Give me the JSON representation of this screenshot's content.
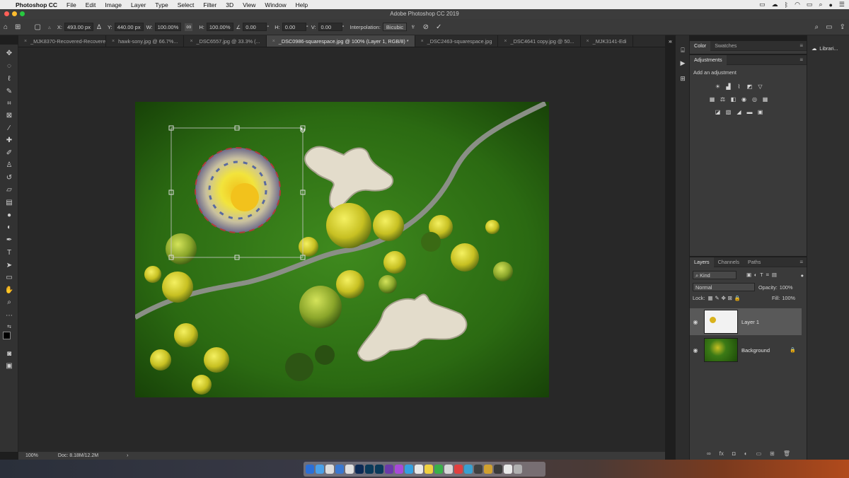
{
  "menubar": {
    "app": "Photoshop CC",
    "items": [
      "File",
      "Edit",
      "Image",
      "Layer",
      "Type",
      "Select",
      "Filter",
      "3D",
      "View",
      "Window",
      "Help"
    ]
  },
  "window_title": "Adobe Photoshop CC 2019",
  "options": {
    "x_label": "X:",
    "x_value": "493.00 px",
    "y_label": "Y:",
    "y_value": "440.00 px",
    "w_label": "W:",
    "w_value": "100.00%",
    "h_label": "H:",
    "h_value": "100.00%",
    "angle_value": "0.00",
    "angle_unit": "°",
    "hskew_label": "H:",
    "hskew_value": "0.00",
    "vskew_label": "V:",
    "vskew_value": "0.00",
    "skew_unit": "°",
    "interp_label": "Interpolation:",
    "interp_value": "Bicubic"
  },
  "tabs": [
    {
      "label": "_MJK8370-Recovered-Recovered.JPG",
      "active": false
    },
    {
      "label": "hawk-sony.jpg @ 66.7%...",
      "active": false
    },
    {
      "label": "_DSC6557.jpg @ 33.3% (...",
      "active": false
    },
    {
      "label": "_DSC0986-squarespace.jpg @ 100% (Layer 1, RGB/8) *",
      "active": true
    },
    {
      "label": "_DSC2463-squarespace.jpg",
      "active": false
    },
    {
      "label": "_DSC4641 copy.jpg @ 50...",
      "active": false
    },
    {
      "label": "_MJK3141-Edi",
      "active": false
    }
  ],
  "status": {
    "zoom": "100%",
    "doc": "Doc: 8.18M/12.2M"
  },
  "color_panel": {
    "tabs": [
      "Color",
      "Swatches"
    ]
  },
  "adjustments_panel": {
    "title": "Adjustments",
    "subtitle": "Add an adjustment"
  },
  "layers_panel": {
    "tabs": [
      "Layers",
      "Channels",
      "Paths"
    ],
    "filter": "Kind",
    "blend": "Normal",
    "opacity_label": "Opacity:",
    "opacity": "100%",
    "lock_label": "Lock:",
    "fill_label": "Fill:",
    "fill": "100%",
    "layers": [
      {
        "name": "Layer 1",
        "active": true
      },
      {
        "name": "Background",
        "active": false
      }
    ]
  },
  "libraries": {
    "label": "Librari..."
  }
}
